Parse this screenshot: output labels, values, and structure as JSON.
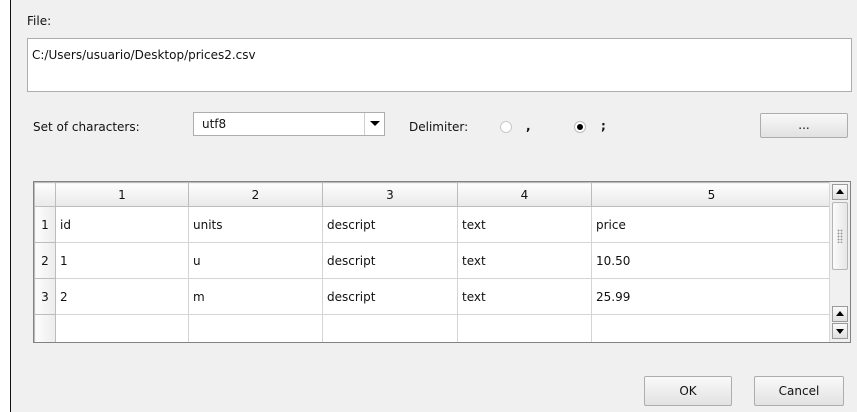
{
  "file": {
    "label": "File:",
    "path": "C:/Users/usuario/Desktop/prices2.csv"
  },
  "charset": {
    "label": "Set of characters:",
    "selected": "utf8"
  },
  "delimiter": {
    "label": "Delimiter:",
    "options": [
      {
        "label": ",",
        "selected": false
      },
      {
        "label": ";",
        "selected": true
      }
    ]
  },
  "buttons": {
    "browse": "...",
    "ok": "OK",
    "cancel": "Cancel"
  },
  "table": {
    "columns": [
      "1",
      "2",
      "3",
      "4",
      "5"
    ],
    "rows": [
      {
        "num": "1",
        "cells": [
          "id",
          "units",
          "descript",
          "text",
          "price"
        ]
      },
      {
        "num": "2",
        "cells": [
          "1",
          "u",
          "descript",
          "text",
          "10.50"
        ]
      },
      {
        "num": "3",
        "cells": [
          "2",
          "m",
          "descript",
          "text",
          "25.99"
        ]
      }
    ]
  },
  "icons": {
    "combo_arrow": "chevron-down-icon",
    "scroll_up": "arrow-up-icon",
    "scroll_down": "arrow-down-icon"
  }
}
